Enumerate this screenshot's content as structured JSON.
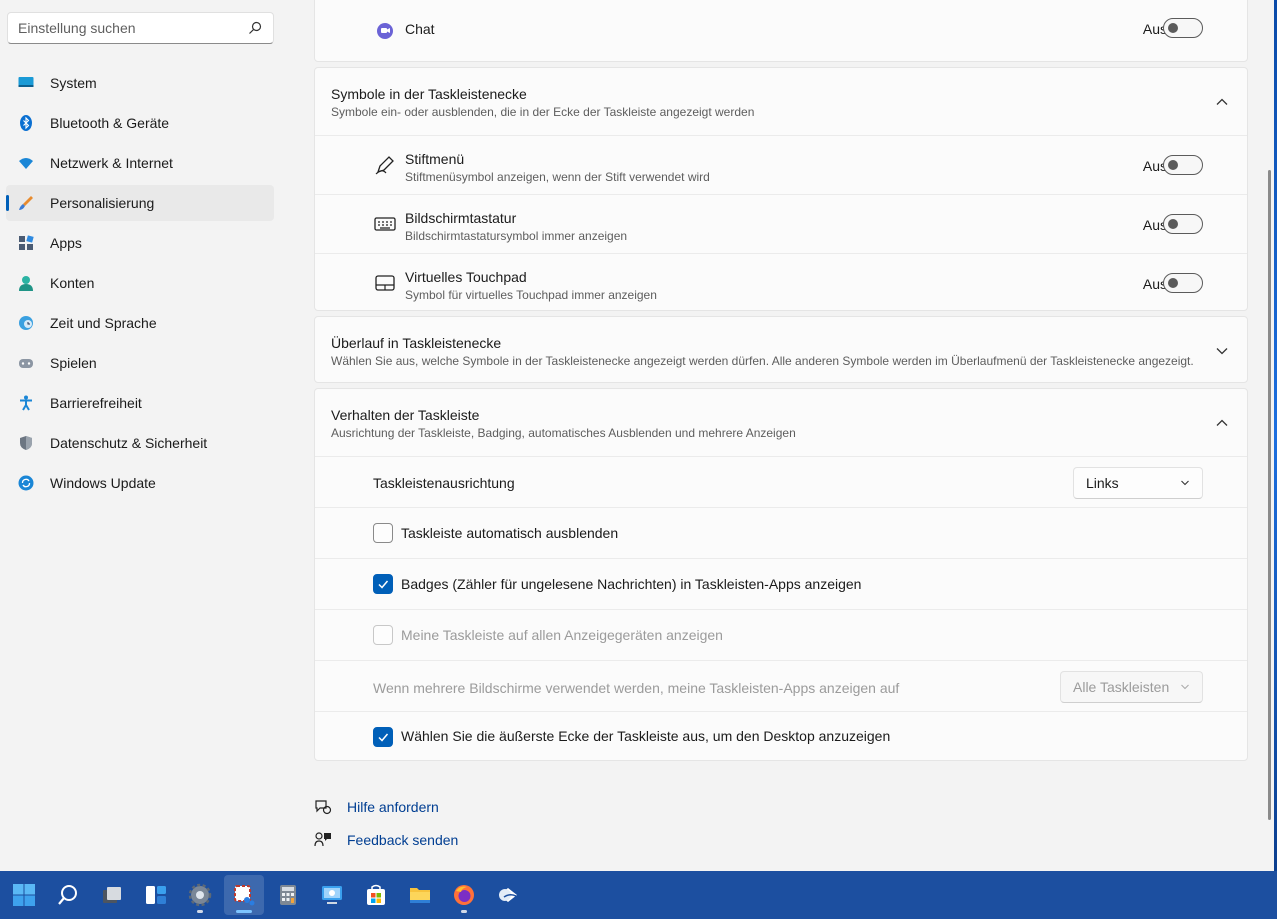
{
  "search": {
    "placeholder": "Einstellung suchen"
  },
  "sidebar": {
    "items": [
      {
        "label": "System",
        "icon": "system-icon"
      },
      {
        "label": "Bluetooth & Geräte",
        "icon": "bluetooth-icon"
      },
      {
        "label": "Netzwerk & Internet",
        "icon": "wifi-icon"
      },
      {
        "label": "Personalisierung",
        "icon": "brush-icon",
        "active": true
      },
      {
        "label": "Apps",
        "icon": "apps-icon"
      },
      {
        "label": "Konten",
        "icon": "account-icon"
      },
      {
        "label": "Zeit und Sprache",
        "icon": "clock-globe-icon"
      },
      {
        "label": "Spielen",
        "icon": "gamepad-icon"
      },
      {
        "label": "Barrierefreiheit",
        "icon": "accessibility-icon"
      },
      {
        "label": "Datenschutz & Sicherheit",
        "icon": "shield-icon"
      },
      {
        "label": "Windows Update",
        "icon": "update-icon"
      }
    ]
  },
  "chat": {
    "title": "Chat",
    "state": "Aus"
  },
  "corner_icons": {
    "title": "Symbole in der Taskleistenecke",
    "subtitle": "Symbole ein- oder ausblenden, die in der Ecke der Taskleiste angezeigt werden",
    "items": [
      {
        "title": "Stiftmenü",
        "subtitle": "Stiftmenüsymbol anzeigen, wenn der Stift verwendet wird",
        "state": "Aus"
      },
      {
        "title": "Bildschirmtastatur",
        "subtitle": "Bildschirmtastatursymbol immer anzeigen",
        "state": "Aus"
      },
      {
        "title": "Virtuelles Touchpad",
        "subtitle": "Symbol für virtuelles Touchpad immer anzeigen",
        "state": "Aus"
      }
    ]
  },
  "overflow": {
    "title": "Überlauf in Taskleistenecke",
    "subtitle": "Wählen Sie aus, welche Symbole in der Taskleistenecke angezeigt werden dürfen. Alle anderen Symbole werden im Überlaufmenü der Taskleistenecke angezeigt."
  },
  "behavior": {
    "title": "Verhalten der Taskleiste",
    "subtitle": "Ausrichtung der Taskleiste, Badging, automatisches Ausblenden und mehrere Anzeigen",
    "alignment_label": "Taskleistenausrichtung",
    "alignment_value": "Links",
    "autohide_label": "Taskleiste automatisch ausblenden",
    "autohide_checked": false,
    "badges_label": "Badges (Zähler für ungelesene Nachrichten) in Taskleisten-Apps anzeigen",
    "badges_checked": true,
    "all_displays_label": "Meine Taskleiste auf allen Anzeigegeräten anzeigen",
    "all_displays_checked": false,
    "multi_label": "Wenn mehrere Bildschirme verwendet werden, meine Taskleisten-Apps anzeigen auf",
    "multi_value": "Alle Taskleisten",
    "corner_label": "Wählen Sie die äußerste Ecke der Taskleiste aus, um den Desktop anzuzeigen",
    "corner_checked": true
  },
  "links": {
    "help": "Hilfe anfordern",
    "feedback": "Feedback senden"
  },
  "taskbar": {
    "apps": [
      "start-icon",
      "search-icon",
      "task-view-icon",
      "widgets-icon",
      "settings-icon",
      "snipping-tool-icon",
      "calculator-icon",
      "remote-desktop-icon",
      "store-icon",
      "file-explorer-icon",
      "firefox-icon",
      "outlook-icon"
    ]
  },
  "colors": {
    "accent": "#005fb8",
    "taskbar": "#1c4fa0",
    "link": "#003e92"
  }
}
